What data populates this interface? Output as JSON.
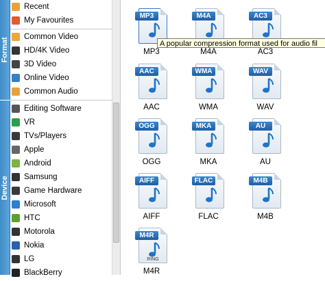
{
  "tabs": {
    "format": "Format",
    "device": "Device"
  },
  "sidebar": {
    "items": [
      {
        "label": "Recent",
        "icon": "recent-icon",
        "color": "#e9a23b"
      },
      {
        "label": "My Favourites",
        "icon": "heart-icon",
        "color": "#e65a2a"
      },
      {
        "label": "Common Video",
        "icon": "common-video-icon",
        "color": "#f0a43a"
      },
      {
        "label": "HD/4K Video",
        "icon": "hd-video-icon",
        "color": "#333333"
      },
      {
        "label": "3D Video",
        "icon": "3d-video-icon",
        "color": "#444444"
      },
      {
        "label": "Online Video",
        "icon": "online-video-icon",
        "color": "#3a7fc4"
      },
      {
        "label": "Common Audio",
        "icon": "common-audio-icon",
        "color": "#e9a23b"
      },
      {
        "label": "Editing Software",
        "icon": "editing-software-icon",
        "color": "#555555"
      },
      {
        "label": "VR",
        "icon": "vr-icon",
        "color": "#2e9e4a"
      },
      {
        "label": "TVs/Players",
        "icon": "tv-icon",
        "color": "#3a3a3a"
      },
      {
        "label": "Apple",
        "icon": "apple-icon",
        "color": "#666666"
      },
      {
        "label": "Android",
        "icon": "android-icon",
        "color": "#7cb342"
      },
      {
        "label": "Samsung",
        "icon": "samsung-icon",
        "color": "#333333"
      },
      {
        "label": "Game Hardware",
        "icon": "game-hardware-icon",
        "color": "#3a3a3a"
      },
      {
        "label": "Microsoft",
        "icon": "microsoft-icon",
        "color": "#2e7fd0"
      },
      {
        "label": "HTC",
        "icon": "htc-icon",
        "color": "#5e9e2e"
      },
      {
        "label": "Motorola",
        "icon": "motorola-icon",
        "color": "#333333"
      },
      {
        "label": "Nokia",
        "icon": "nokia-icon",
        "color": "#2d5fb0"
      },
      {
        "label": "LG",
        "icon": "lg-icon",
        "color": "#333333"
      },
      {
        "label": "BlackBerry",
        "icon": "blackberry-icon",
        "color": "#222222"
      }
    ]
  },
  "formats": [
    {
      "badge": "MP3",
      "label": "MP3",
      "selected": true
    },
    {
      "badge": "M4A",
      "label": "M4A"
    },
    {
      "badge": "AC3",
      "label": "AC3"
    },
    {
      "badge": "AAC",
      "label": "AAC"
    },
    {
      "badge": "WMA",
      "label": "WMA"
    },
    {
      "badge": "WAV",
      "label": "WAV"
    },
    {
      "badge": "OGG",
      "label": "OGG"
    },
    {
      "badge": "MKA",
      "label": "MKA"
    },
    {
      "badge": "AU",
      "label": "AU"
    },
    {
      "badge": "AIFF",
      "label": "AIFF"
    },
    {
      "badge": "FLAC",
      "label": "FLAC"
    },
    {
      "badge": "M4B",
      "label": "M4B"
    },
    {
      "badge": "M4R",
      "label": "M4R",
      "sublabel": "RING"
    }
  ],
  "tooltip": "A popular compression format used for audio fil"
}
